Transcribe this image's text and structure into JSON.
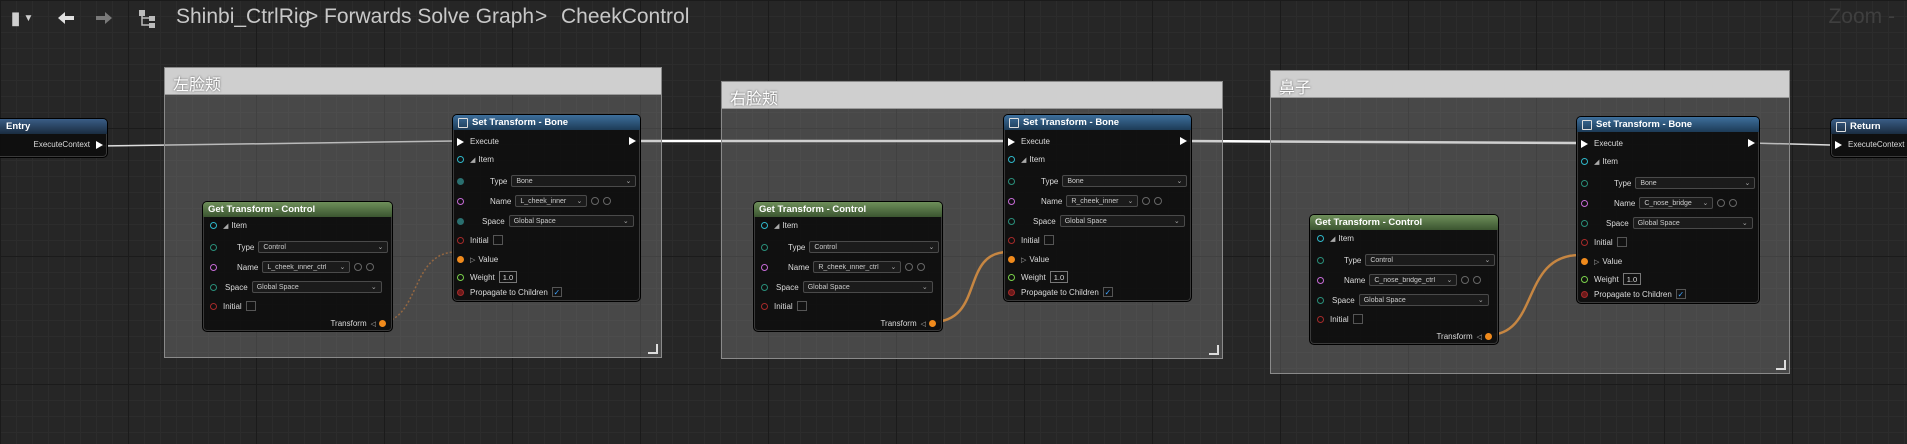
{
  "toolbar": {
    "back_icon": "arrow-left-icon",
    "forward_icon": "arrow-right-icon",
    "breadcrumb": {
      "asset": "Shinbi_CtrlRig",
      "graph": "Forwards Solve Graph",
      "function": "CheekControl",
      "separator": ">"
    },
    "zoom": "Zoom -"
  },
  "comments": [
    {
      "title": "左脸颊"
    },
    {
      "title": "右脸颊"
    },
    {
      "title": "鼻子"
    }
  ],
  "entry": {
    "title": "Entry",
    "pin": "ExecuteContext"
  },
  "return": {
    "title": "Return",
    "pin": "ExecuteContext"
  },
  "get_nodes": [
    {
      "title": "Get Transform - Control",
      "item": "Item",
      "type_label": "Type",
      "type_value": "Control",
      "name_label": "Name",
      "name_value": "L_cheek_inner_ctrl",
      "space_label": "Space",
      "space_value": "Global Space",
      "initial_label": "Initial",
      "out_label": "Transform"
    },
    {
      "title": "Get Transform - Control",
      "item": "Item",
      "type_label": "Type",
      "type_value": "Control",
      "name_label": "Name",
      "name_value": "R_cheek_inner_ctrl",
      "space_label": "Space",
      "space_value": "Global Space",
      "initial_label": "Initial",
      "out_label": "Transform"
    },
    {
      "title": "Get Transform - Control",
      "item": "Item",
      "type_label": "Type",
      "type_value": "Control",
      "name_label": "Name",
      "name_value": "C_nose_bridge_ctrl",
      "space_label": "Space",
      "space_value": "Global Space",
      "initial_label": "Initial",
      "out_label": "Transform"
    }
  ],
  "set_nodes": [
    {
      "title": "Set Transform - Bone",
      "execute": "Execute",
      "item": "Item",
      "type_label": "Type",
      "type_value": "Bone",
      "name_label": "Name",
      "name_value": "L_cheek_inner",
      "space_label": "Space",
      "space_value": "Global Space",
      "initial_label": "Initial",
      "value_label": "Value",
      "weight_label": "Weight",
      "weight_value": "1.0",
      "propagate_label": "Propagate to Children",
      "propagate_checked": "✓"
    },
    {
      "title": "Set Transform - Bone",
      "execute": "Execute",
      "item": "Item",
      "type_label": "Type",
      "type_value": "Bone",
      "name_label": "Name",
      "name_value": "R_cheek_inner",
      "space_label": "Space",
      "space_value": "Global Space",
      "initial_label": "Initial",
      "value_label": "Value",
      "weight_label": "Weight",
      "weight_value": "1.0",
      "propagate_label": "Propagate to Children",
      "propagate_checked": "✓"
    },
    {
      "title": "Set Transform - Bone",
      "execute": "Execute",
      "item": "Item",
      "type_label": "Type",
      "type_value": "Bone",
      "name_label": "Name",
      "name_value": "C_nose_bridge",
      "space_label": "Space",
      "space_value": "Global Space",
      "initial_label": "Initial",
      "value_label": "Value",
      "weight_label": "Weight",
      "weight_value": "1.0",
      "propagate_label": "Propagate to Children",
      "propagate_checked": "✓"
    }
  ],
  "colors": {
    "exec_wire": "#ffffff",
    "transform_wire": "#f08a1c",
    "comment_header": "#cfcfcf"
  }
}
